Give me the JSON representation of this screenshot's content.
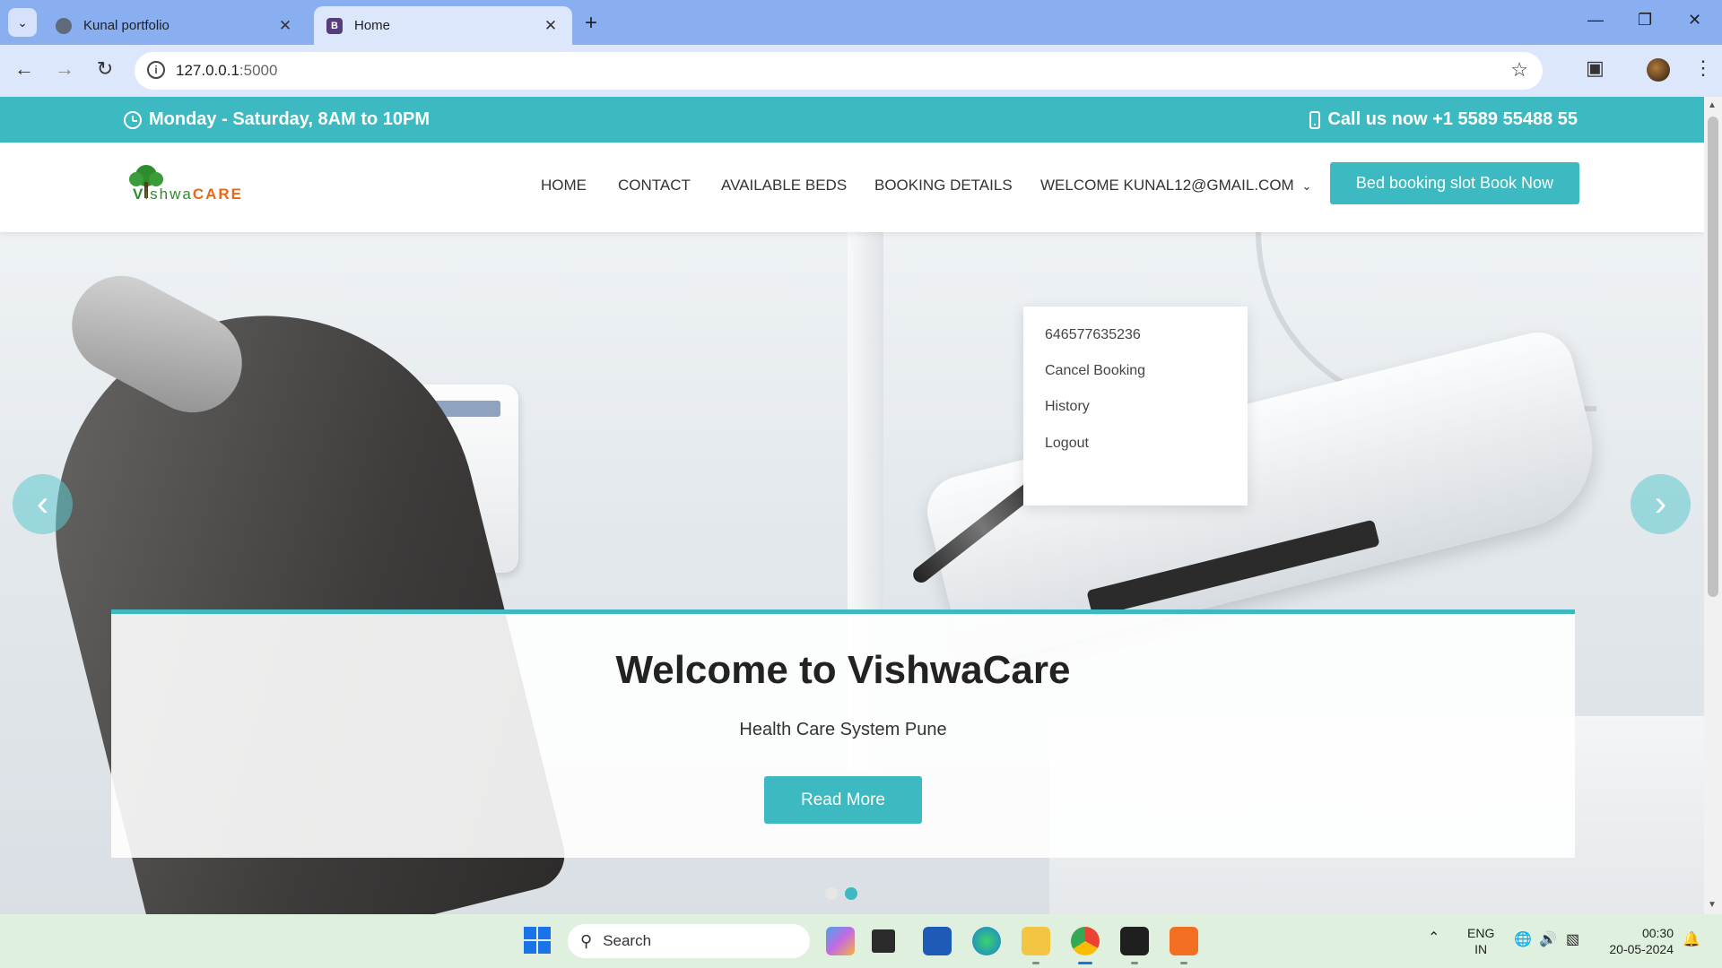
{
  "browser": {
    "tabs": [
      {
        "title": "Kunal portfolio",
        "favicon": "globe-icon"
      },
      {
        "title": "Home",
        "favicon": "bootstrap-icon"
      }
    ],
    "url_host": "127.0.0.1",
    "url_port": ":5000"
  },
  "topbar": {
    "hours": "Monday - Saturday, 8AM to 10PM",
    "call": "Call us now +1 5589 55488 55",
    "color": "#3cb9c1"
  },
  "navbar": {
    "logo": {
      "v": "V",
      "shwa": "ishwa",
      "care": "CARE"
    },
    "items": [
      "HOME",
      "CONTACT",
      "AVAILABLE BEDS",
      "BOOKING DETAILS"
    ],
    "welcome": "WELCOME KUNAL12@GMAIL.COM",
    "book_button": "Bed booking slot Book Now"
  },
  "dropdown": {
    "items": [
      "646577635236",
      "Cancel Booking",
      "History",
      "Logout"
    ]
  },
  "hero": {
    "title": "Welcome to VishwaCare",
    "subtitle": "Health Care System Pune",
    "button": "Read More",
    "slides": 2,
    "active_slide": 2
  },
  "taskbar": {
    "search_placeholder": "Search",
    "lang_line1": "ENG",
    "lang_line2": "IN",
    "time": "00:30",
    "date": "20-05-2024"
  }
}
